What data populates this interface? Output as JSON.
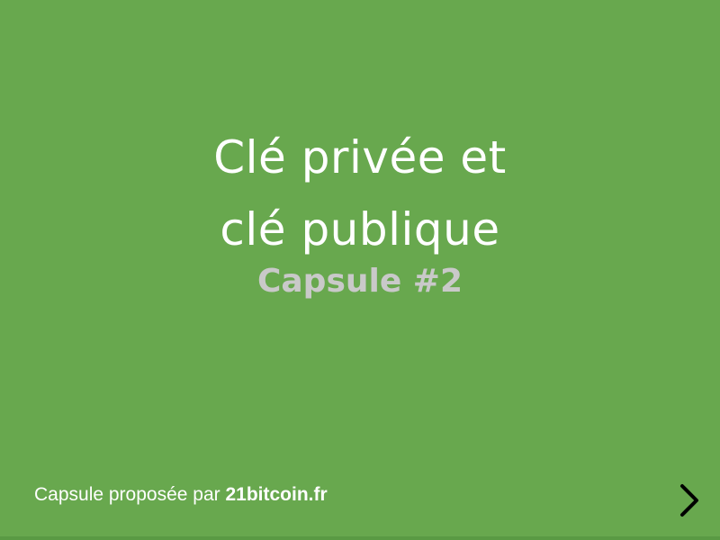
{
  "slide": {
    "title_line1": "Clé privée et",
    "title_line2": "clé publique",
    "subtitle": "Capsule #2"
  },
  "footer": {
    "prefix": "Capsule proposée par ",
    "brand": "21bitcoin.fr"
  },
  "navigation": {
    "next_icon": "chevron-right-icon"
  },
  "colors": {
    "background": "#68a84e",
    "title": "#ffffff",
    "subtitle": "#c9c9c9",
    "footer_text": "#ffffff",
    "chevron": "#000000"
  }
}
